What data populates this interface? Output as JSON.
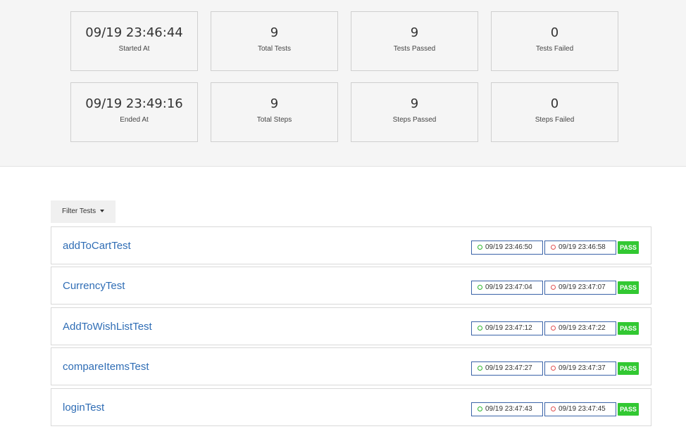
{
  "summary": {
    "started_at": {
      "value": "09/19 23:46:44",
      "label": "Started At"
    },
    "total_tests": {
      "value": "9",
      "label": "Total Tests"
    },
    "tests_passed": {
      "value": "9",
      "label": "Tests Passed"
    },
    "tests_failed": {
      "value": "0",
      "label": "Tests Failed"
    },
    "ended_at": {
      "value": "09/19 23:49:16",
      "label": "Ended At"
    },
    "total_steps": {
      "value": "9",
      "label": "Total Steps"
    },
    "steps_passed": {
      "value": "9",
      "label": "Steps Passed"
    },
    "steps_failed": {
      "value": "0",
      "label": "Steps Failed"
    }
  },
  "filter": {
    "label": "Filter Tests"
  },
  "tests": [
    {
      "name": "addToCartTest",
      "start": "09/19 23:46:50",
      "end": "09/19 23:46:58",
      "status": "PASS"
    },
    {
      "name": "CurrencyTest",
      "start": "09/19 23:47:04",
      "end": "09/19 23:47:07",
      "status": "PASS"
    },
    {
      "name": "AddToWishListTest",
      "start": "09/19 23:47:12",
      "end": "09/19 23:47:22",
      "status": "PASS"
    },
    {
      "name": "compareItemsTest",
      "start": "09/19 23:47:27",
      "end": "09/19 23:47:37",
      "status": "PASS"
    },
    {
      "name": "loginTest",
      "start": "09/19 23:47:43",
      "end": "09/19 23:47:45",
      "status": "PASS"
    }
  ],
  "colors": {
    "pass": "#32c832",
    "link": "#2f6db5",
    "start_clock": "#2bb52b",
    "end_clock": "#e05050"
  }
}
